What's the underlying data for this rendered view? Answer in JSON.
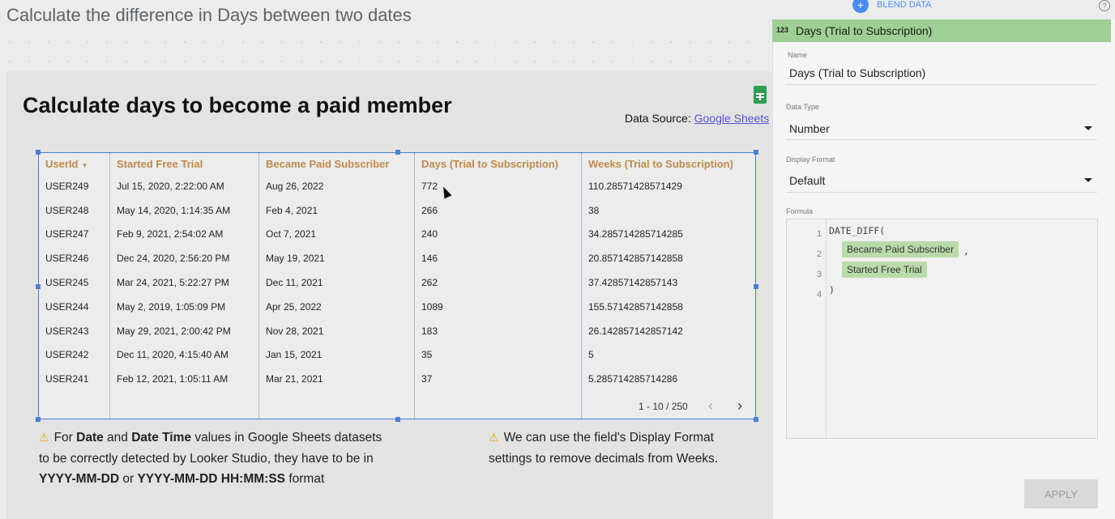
{
  "page": {
    "title": "Calculate the difference in Days between two dates"
  },
  "report": {
    "title": "Calculate days to become a paid member",
    "data_source_label": "Data Source: ",
    "data_source_link": "Google Sheets"
  },
  "table": {
    "headers": [
      "UserId",
      "Started Free Trial",
      "Became Paid Subscriber",
      "Days (Trial to Subscription)",
      "Weeks (Trial to Subscription)"
    ],
    "rows": [
      [
        "USER249",
        "Jul 15, 2020, 2:22:00 AM",
        "Aug 26, 2022",
        "772",
        "110.28571428571429"
      ],
      [
        "USER248",
        "May 14, 2020, 1:14:35 AM",
        "Feb 4, 2021",
        "266",
        "38"
      ],
      [
        "USER247",
        "Feb 9, 2021, 2:54:02 AM",
        "Oct 7, 2021",
        "240",
        "34.285714285714285"
      ],
      [
        "USER246",
        "Dec 24, 2020, 2:56:20 PM",
        "May 19, 2021",
        "146",
        "20.857142857142858"
      ],
      [
        "USER245",
        "Mar 24, 2021, 5:22:27 PM",
        "Dec 11, 2021",
        "262",
        "37.42857142857143"
      ],
      [
        "USER244",
        "May 2, 2019, 1:05:09 PM",
        "Apr 25, 2022",
        "1089",
        "155.57142857142858"
      ],
      [
        "USER243",
        "May 29, 2021, 2:00:42 PM",
        "Nov 28, 2021",
        "183",
        "26.142857142857142"
      ],
      [
        "USER242",
        "Dec 11, 2020, 4:15:40 AM",
        "Jan 15, 2021",
        "35",
        "5"
      ],
      [
        "USER241",
        "Feb 12, 2021, 1:05:11 AM",
        "Mar 21, 2021",
        "37",
        "5.285714285714286"
      ]
    ],
    "pager": "1 - 10 / 250"
  },
  "notes": {
    "left": {
      "p1": "For ",
      "b1": "Date",
      "p2": " and ",
      "b2": "Date Time",
      "p3": " values in Google Sheets datasets",
      "line2": "to be correctly detected by Looker Studio, they have to be in",
      "b3": "YYYY-MM-DD",
      "p4": " or ",
      "b4": "YYYY-MM-DD HH:MM:SS",
      "p5": " format"
    },
    "right": {
      "line1": "We can use the field's Display Format",
      "line2": "settings to remove decimals from Weeks."
    }
  },
  "panel": {
    "blend_label": "BLEND DATA",
    "type_badge": "123",
    "header_title": "Days (Trial to Subscription)",
    "name_label": "Name",
    "name_value": "Days (Trial to Subscription)",
    "data_type_label": "Data Type",
    "data_type_value": "Number",
    "display_format_label": "Display Format",
    "display_format_value": "Default",
    "formula_label": "Formula",
    "formula": {
      "line_numbers": [
        "1",
        "2",
        "3",
        "4"
      ],
      "func": "DATE_DIFF(",
      "arg1": "Became Paid Subscriber",
      "comma": ",",
      "arg2": "Started Free Trial",
      "close": ")"
    },
    "apply_label": "APPLY"
  },
  "colors": {
    "header_green": "#9fcf94",
    "chip_green": "#b9dbaa",
    "table_header": "#c08a4a",
    "selection_blue": "#4a7fd4",
    "link": "#5a52d6"
  }
}
